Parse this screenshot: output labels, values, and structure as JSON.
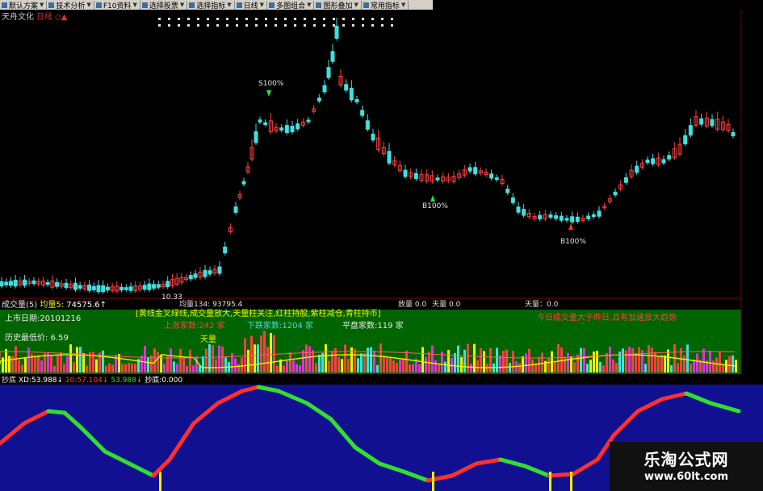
{
  "toolbar": {
    "buttons": [
      {
        "label": "默认方案",
        "icon": "scheme-icon",
        "has_dropdown": true
      },
      {
        "label": "技术分析",
        "icon": "analysis-icon",
        "has_dropdown": true
      },
      {
        "label": "F10资料",
        "icon": "f10-icon",
        "has_dropdown": true
      },
      {
        "label": "选择股票",
        "icon": "stock-select-icon",
        "has_dropdown": true
      },
      {
        "label": "选择指标",
        "icon": "indicator-select-icon",
        "has_dropdown": true
      },
      {
        "label": "日线",
        "icon": "period-icon",
        "has_dropdown": true
      },
      {
        "label": "多图组合",
        "icon": "multi-chart-icon",
        "has_dropdown": true
      },
      {
        "label": "图形叠加",
        "icon": "overlay-icon",
        "has_dropdown": true
      },
      {
        "label": "常用指标",
        "icon": "common-indicator-icon",
        "has_dropdown": true
      }
    ]
  },
  "stock": {
    "name": "天舟文化",
    "period": "日线",
    "flag": "◇▲"
  },
  "main_chart": {
    "annotations": [
      {
        "text": "S100%"
      },
      {
        "text": "B100%"
      },
      {
        "text": "B100%"
      },
      {
        "text": "10.33"
      }
    ]
  },
  "volume_header": {
    "label": "成交量(5)",
    "ma_label": "均量5:",
    "ma_value": "74575.6↑",
    "mid_items": [
      "均量134:",
      "93795.4"
    ],
    "tail_items": [
      "放量",
      "0.0",
      "天量",
      "0.0"
    ],
    "bottom_item": "天量：",
    "bottom_value": "0.0"
  },
  "info_panel": {
    "listing_date": "上市日期:20101216",
    "historical_min": "历史最低价:",
    "historical_min_value": "6.59",
    "legend": "[黄线金叉绿线,成交量放大,天量柱关注,红柱持股,紫柱减仓,青柱持币]",
    "up_count": "上涨家数:242 家",
    "down_count": "下跌家数:1204 家",
    "flat_count": "平盘家数:119 家",
    "today_note": "今日成交量大于昨日,且有加速放大趋势",
    "tianliang": "天量"
  },
  "oscillator": {
    "name": "抄底",
    "params": [
      {
        "label": "XD:",
        "value": "53.988↓"
      },
      {
        "label": "10:",
        "value": "57.104↓"
      },
      {
        "label": "",
        "value": "53.988↓"
      },
      {
        "label": "抄底:",
        "value": "0.000"
      }
    ]
  },
  "watermark": {
    "title": "乐淘公式网",
    "url": "www.60lt.com"
  },
  "colors": {
    "up": "#ff4040",
    "down": "#40e0e0",
    "volume_panel_bg": "#006400",
    "oscillator_bg": "#101090",
    "osc_red": "#ff3030",
    "osc_green": "#30e030",
    "yellow": "#f0f000"
  }
}
